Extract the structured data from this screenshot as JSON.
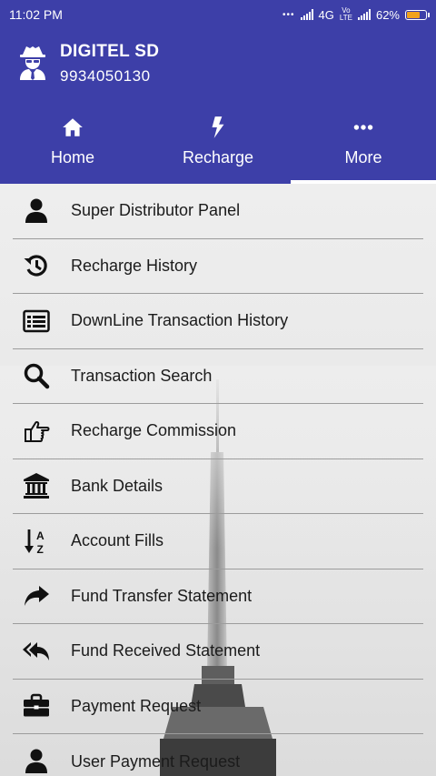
{
  "status_bar": {
    "time": "11:02 PM",
    "network": "4G",
    "battery": "62%",
    "battery_level": 0.62,
    "battery_color": "#f0a21c"
  },
  "profile": {
    "name": "DIGITEL SD",
    "phone": "9934050130",
    "avatar_icon": "spy-user-icon"
  },
  "tabs": [
    {
      "label": "Home",
      "icon": "home-icon"
    },
    {
      "label": "Recharge",
      "icon": "lightning-icon"
    },
    {
      "label": "More",
      "icon": "more-dots-icon",
      "active": true
    }
  ],
  "menu": [
    {
      "label": "Super Distributor Panel",
      "icon": "user-icon"
    },
    {
      "label": "Recharge History",
      "icon": "history-icon"
    },
    {
      "label": "DownLine Transaction History",
      "icon": "list-alt-icon"
    },
    {
      "label": "Transaction Search",
      "icon": "search-icon"
    },
    {
      "label": "Recharge Commission",
      "icon": "hand-point-right-icon"
    },
    {
      "label": "Bank Details",
      "icon": "bank-icon"
    },
    {
      "label": "Account Fills",
      "icon": "sort-alpha-icon"
    },
    {
      "label": "Fund Transfer Statement",
      "icon": "share-arrow-icon"
    },
    {
      "label": "Fund Received Statement",
      "icon": "reply-all-icon"
    },
    {
      "label": "Payment Request",
      "icon": "briefcase-icon"
    },
    {
      "label": "User Payment Request",
      "icon": "user-icon"
    }
  ],
  "colors": {
    "primary": "#3d3fa8",
    "text": "#1b1b1b",
    "divider": "#9c9c9c"
  }
}
